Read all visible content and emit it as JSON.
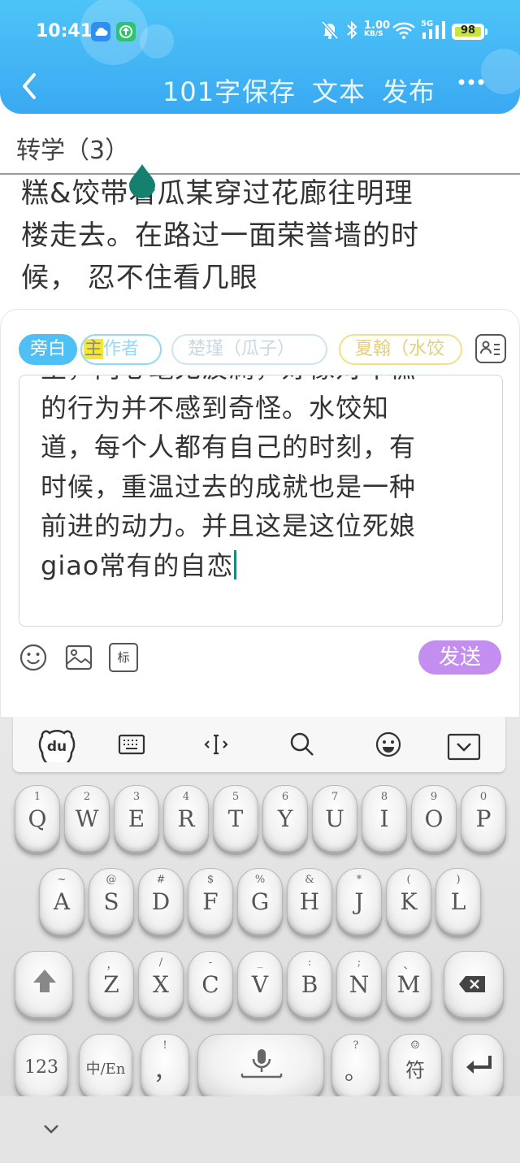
{
  "status_bar": {
    "time": "10:41",
    "network_speed": "1.00",
    "network_unit": "KB/S",
    "network_type": "5G",
    "battery": "98",
    "icons": [
      "weather-cloud-icon",
      "green-app-icon",
      "mute-bell-icon",
      "bluetooth-icon",
      "wifi-icon",
      "signal-icon",
      "battery-icon"
    ]
  },
  "header": {
    "word_count": "101字",
    "save": "保存",
    "text": "文本",
    "publish": "发布"
  },
  "chapter": {
    "title": "转学（3）"
  },
  "story": {
    "line1": "糕&饺带着瓜某穿过花廊往明理",
    "line2": "楼走去。在路过一面荣誉墙的时",
    "line3": "候， 忍不住看几眼"
  },
  "compose": {
    "roles": {
      "narration": "旁白",
      "author_hl": "主",
      "author_rest": "作者",
      "chujin": "楚瑾（瓜子）",
      "xiahan": "夏翰（水饺"
    },
    "input_lines": [
      "里，内心毫无波澜，好像对年糕",
      "的行为并不感到奇怪。水饺知",
      "道，每个人都有自己的时刻，有",
      "时候，重温过去的成就也是一种",
      "前进的动力。并且这是这位死娘",
      "giao常有的自恋"
    ],
    "send": "发送",
    "tag_label": "标"
  },
  "keyboard": {
    "row1": [
      [
        "1",
        "Q"
      ],
      [
        "2",
        "W"
      ],
      [
        "3",
        "E"
      ],
      [
        "4",
        "R"
      ],
      [
        "5",
        "T"
      ],
      [
        "6",
        "Y"
      ],
      [
        "7",
        "U"
      ],
      [
        "8",
        "I"
      ],
      [
        "9",
        "O"
      ],
      [
        "0",
        "P"
      ]
    ],
    "row2": [
      [
        "~",
        "A"
      ],
      [
        "@",
        "S"
      ],
      [
        "#",
        "D"
      ],
      [
        "$",
        "F"
      ],
      [
        "%",
        "G"
      ],
      [
        "&",
        "H"
      ],
      [
        "*",
        "J"
      ],
      [
        "(",
        "K"
      ],
      [
        ")",
        "L"
      ]
    ],
    "row3": [
      [
        "，",
        "Z"
      ],
      [
        "/",
        "X"
      ],
      [
        "-",
        "C"
      ],
      [
        "_",
        "V"
      ],
      [
        ":",
        "B"
      ],
      [
        ";",
        "N"
      ],
      [
        "、",
        "M"
      ]
    ],
    "num_key": "123",
    "lang_key": "中/En",
    "comma_sub": "!",
    "comma": "，",
    "period_sub": "?",
    "period": "。",
    "symbol_sub": "☺",
    "symbol": "符"
  },
  "colors": {
    "header": "#3aa9f2",
    "narration_chip": "#4fc0f3",
    "send_button": "#c38ef0",
    "caret": "#1a8a7a",
    "highlight": "#f5e82e"
  }
}
